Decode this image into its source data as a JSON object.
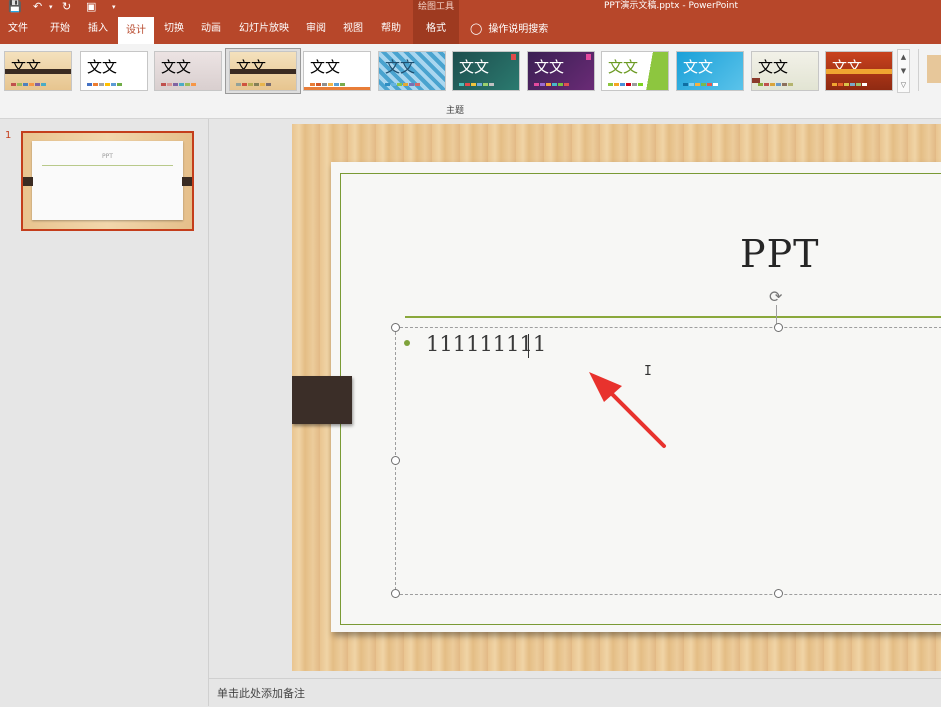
{
  "window": {
    "context_tools_label": "绘图工具",
    "document_title": "PPT演示文稿.pptx  -  PowerPoint"
  },
  "menu": {
    "tabs": [
      {
        "label": "文件"
      },
      {
        "label": "开始"
      },
      {
        "label": "插入"
      },
      {
        "label": "设计",
        "active": true
      },
      {
        "label": "切换"
      },
      {
        "label": "动画"
      },
      {
        "label": "幻灯片放映"
      },
      {
        "label": "审阅"
      },
      {
        "label": "视图"
      },
      {
        "label": "帮助"
      },
      {
        "label": "格式"
      }
    ],
    "tell_me": "操作说明搜索"
  },
  "ribbon": {
    "group_label": "主题",
    "theme_sample_text": "文文",
    "themes_count": 12
  },
  "thumbnails": {
    "slide_number": "1",
    "thumb_title": "PPT"
  },
  "slide": {
    "title": "PPT",
    "bullet_text": "111111111"
  },
  "notes": {
    "placeholder": "单击此处添加备注"
  },
  "colors": {
    "accent": "#b7472a",
    "annotation_arrow": "#e8322d",
    "title_rule": "#8aa83b"
  }
}
